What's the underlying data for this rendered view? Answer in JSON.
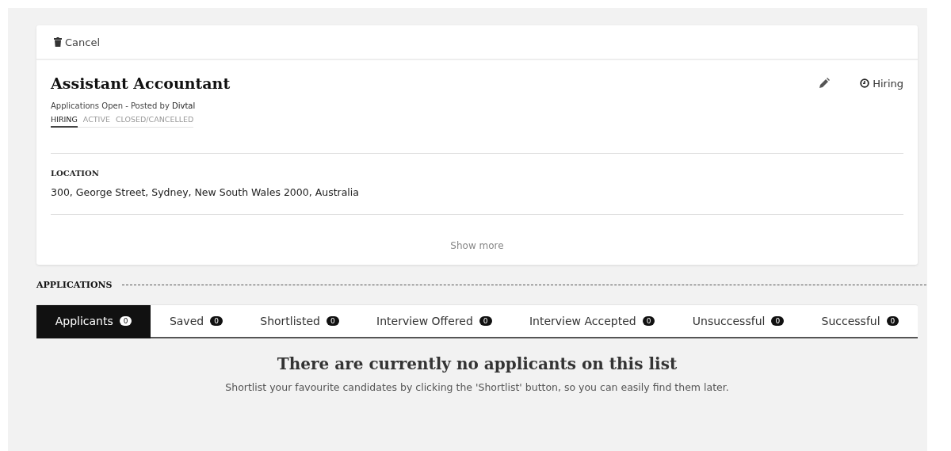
{
  "toolbar": {
    "cancel_label": "Cancel"
  },
  "job": {
    "title": "Assistant Accountant",
    "status_label": "Hiring",
    "subtitle": "Applications Open - Posted by",
    "poster": "Divtal",
    "stages": [
      {
        "label": "HIRING",
        "selected": true
      },
      {
        "label": "ACTIVE",
        "selected": false
      },
      {
        "label": "CLOSED/CANCELLED",
        "selected": false
      }
    ],
    "location_heading": "LOCATION",
    "location": "300, George Street, Sydney, New South Wales 2000, Australia",
    "show_more": "Show more"
  },
  "applications": {
    "heading": "APPLICATIONS",
    "tabs": [
      {
        "label": "Applicants",
        "count": "0",
        "selected": true
      },
      {
        "label": "Saved",
        "count": "0",
        "selected": false
      },
      {
        "label": "Shortlisted",
        "count": "0",
        "selected": false
      },
      {
        "label": "Interview Offered",
        "count": "0",
        "selected": false
      },
      {
        "label": "Interview Accepted",
        "count": "0",
        "selected": false
      },
      {
        "label": "Unsuccessful",
        "count": "0",
        "selected": false
      },
      {
        "label": "Successful",
        "count": "0",
        "selected": false
      }
    ],
    "empty_title": "There are currently no applicants on this list",
    "empty_text": "Shortlist your favourite candidates by clicking the 'Shortlist' button, so you can easily find them later."
  }
}
